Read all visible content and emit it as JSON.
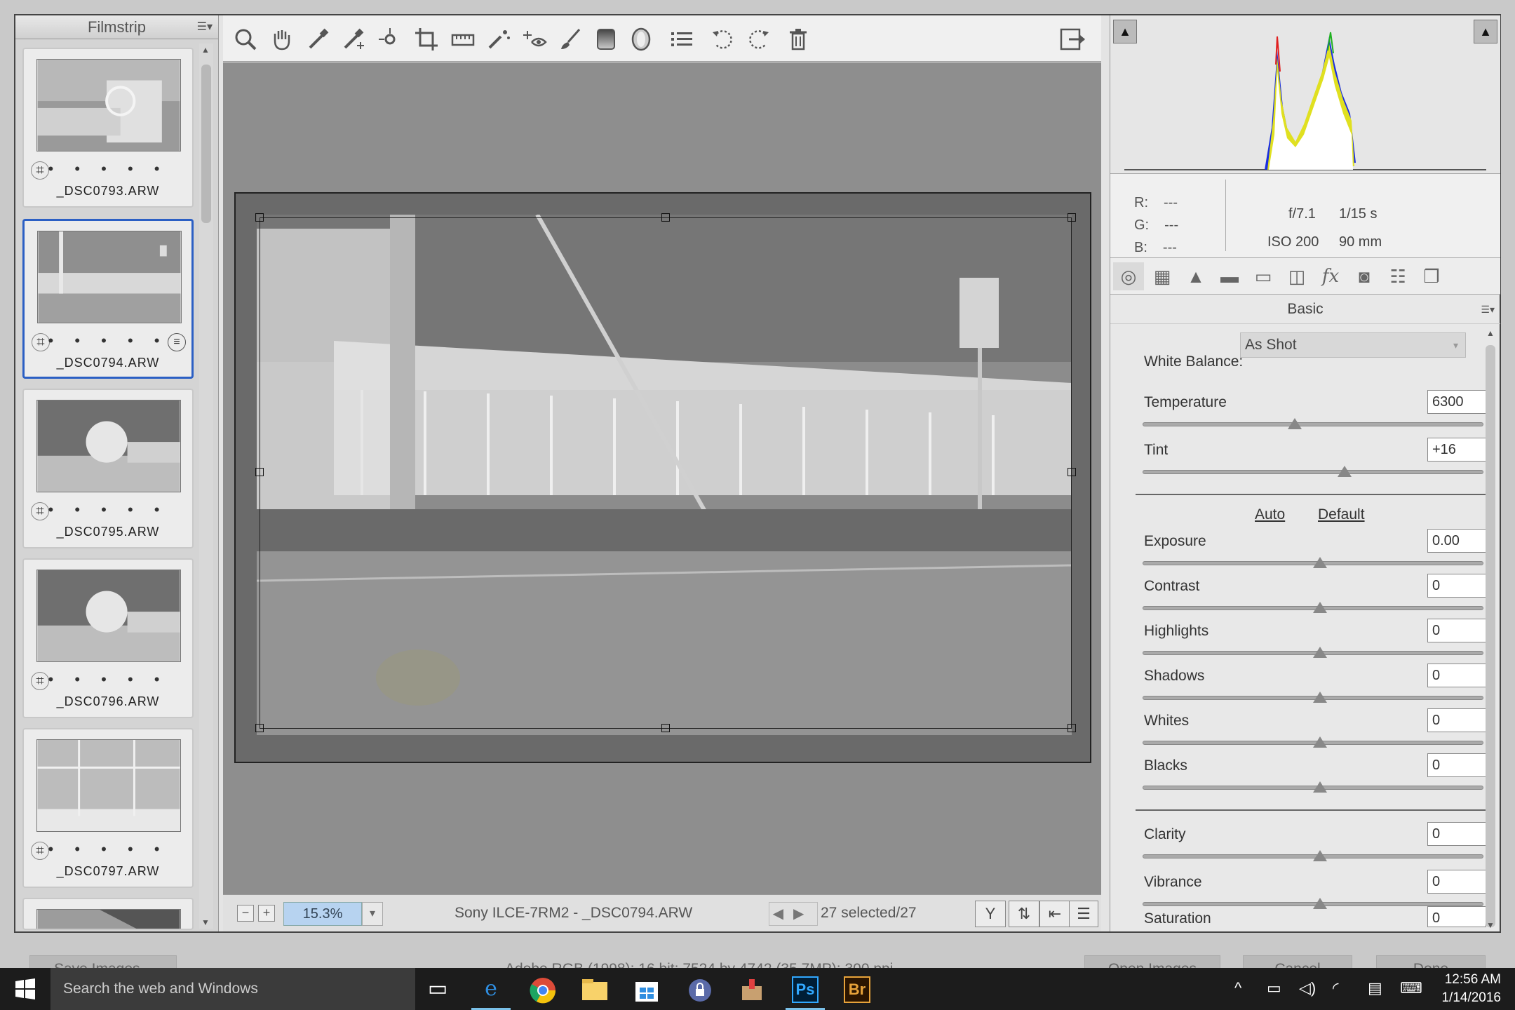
{
  "filmstrip": {
    "title": "Filmstrip",
    "items": [
      {
        "name": "_DSC0793.ARW",
        "selected": false
      },
      {
        "name": "_DSC0794.ARW",
        "selected": true
      },
      {
        "name": "_DSC0795.ARW",
        "selected": false
      },
      {
        "name": "_DSC0796.ARW",
        "selected": false
      },
      {
        "name": "_DSC0797.ARW",
        "selected": false
      }
    ],
    "stars": "• • • • •"
  },
  "toolbar": {
    "tools": [
      "zoom-tool-icon",
      "hand-tool-icon",
      "white-balance-tool-icon",
      "color-sampler-tool-icon",
      "targeted-adjustment-tool-icon",
      "crop-tool-icon",
      "straighten-tool-icon",
      "spot-removal-tool-icon",
      "red-eye-removal-tool-icon",
      "adjustment-brush-tool-icon",
      "graduated-filter-tool-icon",
      "radial-filter-tool-icon",
      "preferences-icon",
      "rotate-left-icon",
      "rotate-right-icon",
      "trash-icon"
    ]
  },
  "statusbar": {
    "zoom": "15.3%",
    "camera": "Sony ILCE-7RM2  -  _DSC0794.ARW",
    "selected": "27 selected/27"
  },
  "info": {
    "r_label": "R:",
    "g_label": "G:",
    "b_label": "B:",
    "r": "---",
    "g": "---",
    "b": "---",
    "aperture": "f/7.1",
    "shutter": "1/15 s",
    "iso": "ISO 200",
    "focal": "90 mm"
  },
  "panel": {
    "title": "Basic",
    "white_balance_label": "White Balance:",
    "white_balance_value": "As Shot",
    "auto": "Auto",
    "default": "Default",
    "sliders": [
      {
        "label": "Temperature",
        "value": "6300",
        "pos": 0.43
      },
      {
        "label": "Tint",
        "value": "+16",
        "pos": 0.58
      },
      {
        "label": "Exposure",
        "value": "0.00",
        "pos": 0.5
      },
      {
        "label": "Contrast",
        "value": "0",
        "pos": 0.5
      },
      {
        "label": "Highlights",
        "value": "0",
        "pos": 0.5
      },
      {
        "label": "Shadows",
        "value": "0",
        "pos": 0.5
      },
      {
        "label": "Whites",
        "value": "0",
        "pos": 0.5
      },
      {
        "label": "Blacks",
        "value": "0",
        "pos": 0.5
      },
      {
        "label": "Clarity",
        "value": "0",
        "pos": 0.5
      },
      {
        "label": "Vibrance",
        "value": "0",
        "pos": 0.5
      },
      {
        "label": "Saturation",
        "value": "0",
        "pos": 0.5
      }
    ]
  },
  "dialog": {
    "left_button": "Save Images...",
    "image_info": "Adobe RGB (1998); 16 bit; 7524 by 4742 (35.7MP); 300 ppi",
    "open_button": "Open Images",
    "cancel_button": "Cancel",
    "done_button": "Done"
  },
  "taskbar": {
    "search_placeholder": "Search the web and Windows",
    "time": "12:56 AM",
    "date": "1/14/2016",
    "apps": [
      "task-view-icon",
      "edge-icon",
      "chrome-icon",
      "file-explorer-icon",
      "store-icon",
      "keepass-icon",
      "app-icon",
      "photoshop-icon",
      "bridge-icon"
    ],
    "ps_label": "Ps",
    "br_label": "Br"
  },
  "colors": {
    "accent": "#2b5fc4",
    "zoom_bg": "#b7d3f0"
  }
}
